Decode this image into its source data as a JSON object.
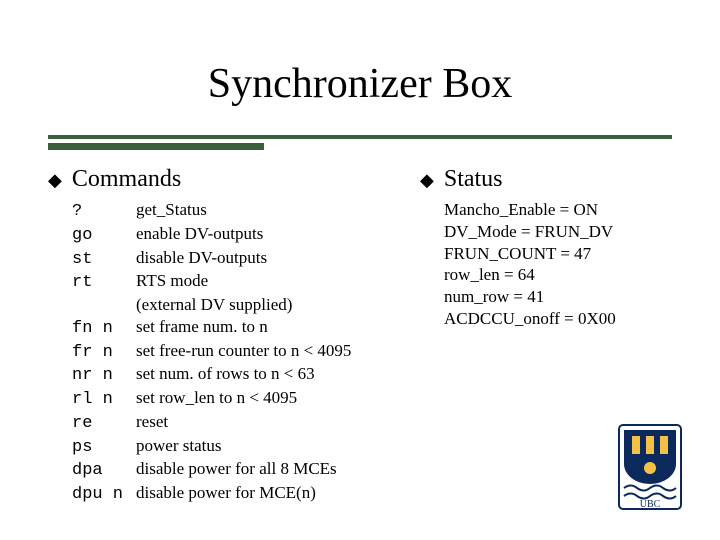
{
  "title": "Synchronizer Box",
  "headings": {
    "commands": "Commands",
    "status": "Status"
  },
  "commands": [
    {
      "cmd": "?",
      "desc": "get_Status"
    },
    {
      "cmd": "go",
      "desc": "enable DV-outputs"
    },
    {
      "cmd": "st",
      "desc": "disable DV-outputs"
    },
    {
      "cmd": "rt",
      "desc": "RTS mode"
    },
    {
      "cmd": "",
      "desc": "(external DV supplied)",
      "cont": true
    },
    {
      "cmd": "fn n",
      "desc": "set frame num. to  n"
    },
    {
      "cmd": "fr n",
      "desc": "set free-run counter to n < 4095"
    },
    {
      "cmd": "nr n",
      "desc": "set num. of rows to n < 63"
    },
    {
      "cmd": "rl n",
      "desc": "set row_len to n < 4095"
    },
    {
      "cmd": "re",
      "desc": "reset"
    },
    {
      "cmd": "ps",
      "desc": "power status"
    },
    {
      "cmd": "dpa",
      "desc": "disable power for all 8 MCEs"
    },
    {
      "cmd": "dpu n",
      "desc": "disable power for MCE(n)"
    }
  ],
  "status": [
    "Mancho_Enable = ON",
    "DV_Mode = FRUN_DV",
    "FRUN_COUNT = 47",
    "row_len = 64",
    "num_row = 41",
    "ACDCCU_onoff = 0X00"
  ],
  "logo_label": "UBC"
}
